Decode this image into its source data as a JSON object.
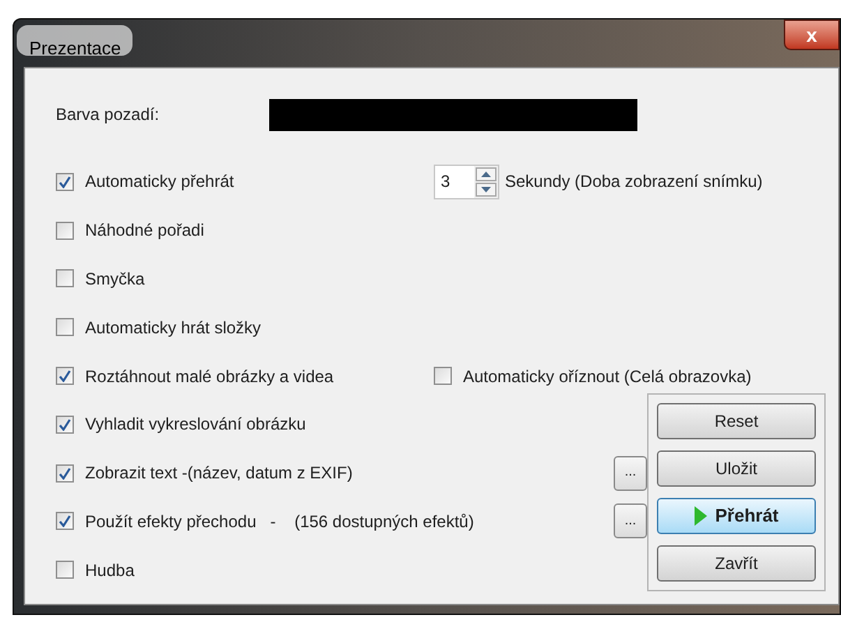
{
  "window": {
    "title": "Prezentace",
    "close": "x"
  },
  "background": {
    "label": "Barva pozadí:"
  },
  "options": [
    {
      "label": "Automaticky přehrát",
      "checked": true,
      "spinner": {
        "value": "3",
        "label": "Sekundy (Doba zobrazení snímku)"
      }
    },
    {
      "label": "Náhodné pořadi",
      "checked": false
    },
    {
      "label": "Smyčka",
      "checked": false
    },
    {
      "label": "Automaticky hrát složky",
      "checked": false
    },
    {
      "label": "Roztáhnout malé obrázky a videa",
      "checked": true,
      "side_option": {
        "label": "Automaticky oříznout (Celá obrazovka)",
        "checked": false
      }
    },
    {
      "label": "Vyhladit vykreslování obrázku",
      "checked": true
    },
    {
      "label": "Zobrazit text -(název, datum z EXIF)",
      "checked": true,
      "more_button": "..."
    },
    {
      "label": "Použít efekty přechodu   -    (156 dostupných efektů)",
      "checked": true,
      "more_button": "..."
    },
    {
      "label": "Hudba",
      "checked": false
    }
  ],
  "buttons": [
    {
      "label": "Reset",
      "kind": "plain",
      "default": false
    },
    {
      "label": "Uložit",
      "kind": "plain",
      "default": false
    },
    {
      "label": "Přehrát",
      "kind": "play",
      "default": true
    },
    {
      "label": "Zavřít",
      "kind": "plain",
      "default": false
    }
  ]
}
